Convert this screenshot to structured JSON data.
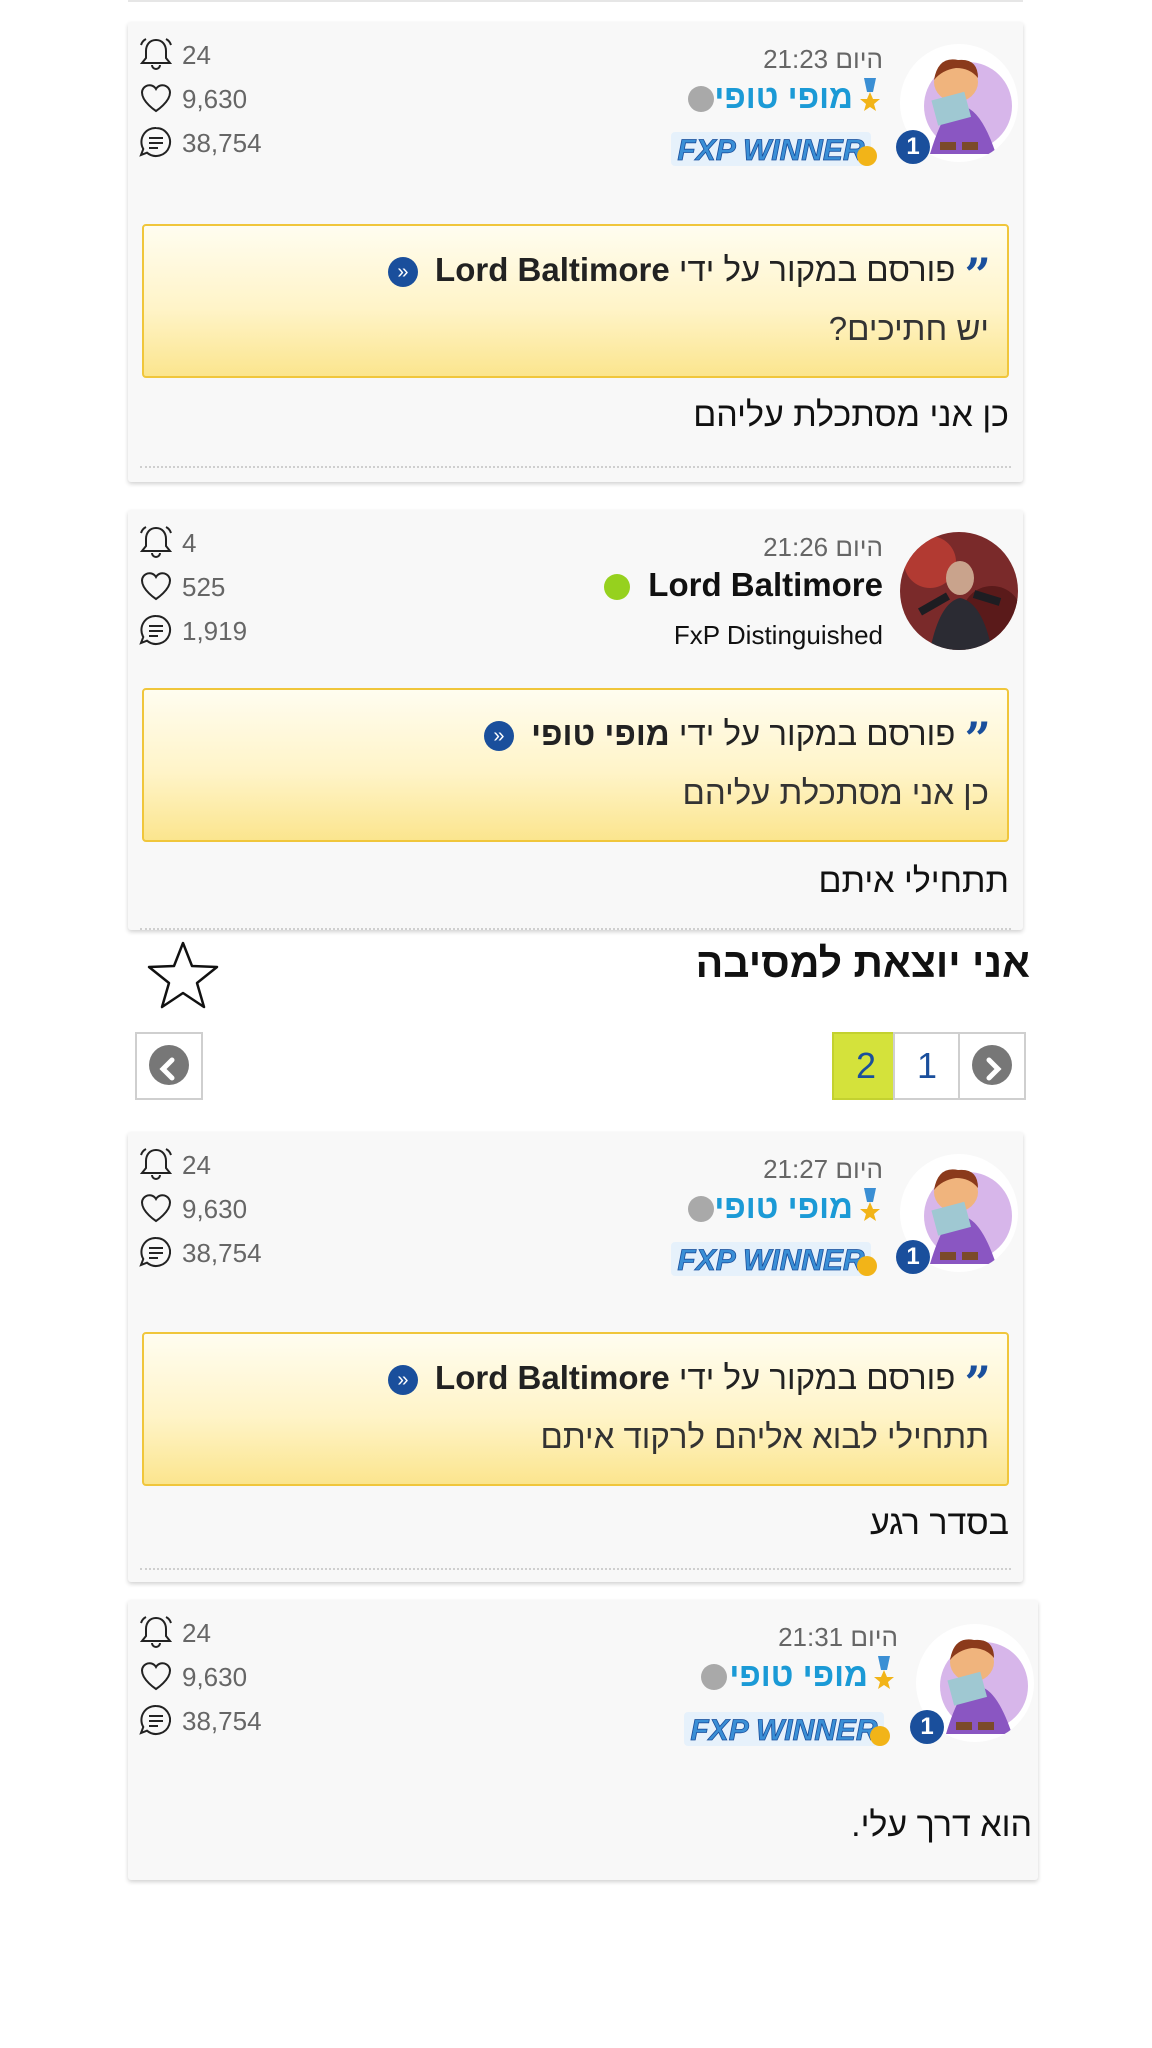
{
  "posts": [
    {
      "bell_count": "24",
      "likes": "9,630",
      "messages": "38,754",
      "time": "היום 21:23",
      "username": "מופי טופי",
      "banner_text": "FXP WINNER",
      "rank_badge": "1",
      "quote_header": "פורסם במקור על ידי",
      "quote_author": "Lord Baltimore",
      "quote_text": "יש חתיכים?",
      "message": "כן אני מסתכלת עליהם"
    },
    {
      "bell_count": "4",
      "likes": "525",
      "messages": "1,919",
      "time": "היום 21:26",
      "username": "Lord Baltimore",
      "user_title": "FxP Distinguished",
      "quote_header": "פורסם במקור על ידי",
      "quote_author": "מופי טופי",
      "quote_text": "כן אני מסתכלת עליהם",
      "message": "תתחילי איתם"
    },
    {
      "bell_count": "24",
      "likes": "9,630",
      "messages": "38,754",
      "time": "היום 21:27",
      "username": "מופי טופי",
      "banner_text": "FXP WINNER",
      "rank_badge": "1",
      "quote_header": "פורסם במקור על ידי",
      "quote_author": "Lord Baltimore",
      "quote_text": "תתחילי לבוא אליהם לרקוד איתם",
      "message": "בסדר רגע"
    },
    {
      "bell_count": "24",
      "likes": "9,630",
      "messages": "38,754",
      "time": "היום 21:31",
      "username": "מופי טופי",
      "banner_text": "FXP WINNER",
      "rank_badge": "1",
      "message": "הוא דרך עלי."
    }
  ],
  "thread": {
    "title": "אני יוצאת למסיבה"
  },
  "pagination": {
    "pages": [
      "2",
      "1"
    ],
    "current": "2"
  },
  "colors": {
    "username_blue": "#1b9ad6",
    "online_green": "#96d11e",
    "offline_gray": "#a9a9a9",
    "quote_border": "#f0c63b",
    "page_active": "#d4e23b",
    "accent_navy": "#1a4f9c"
  }
}
